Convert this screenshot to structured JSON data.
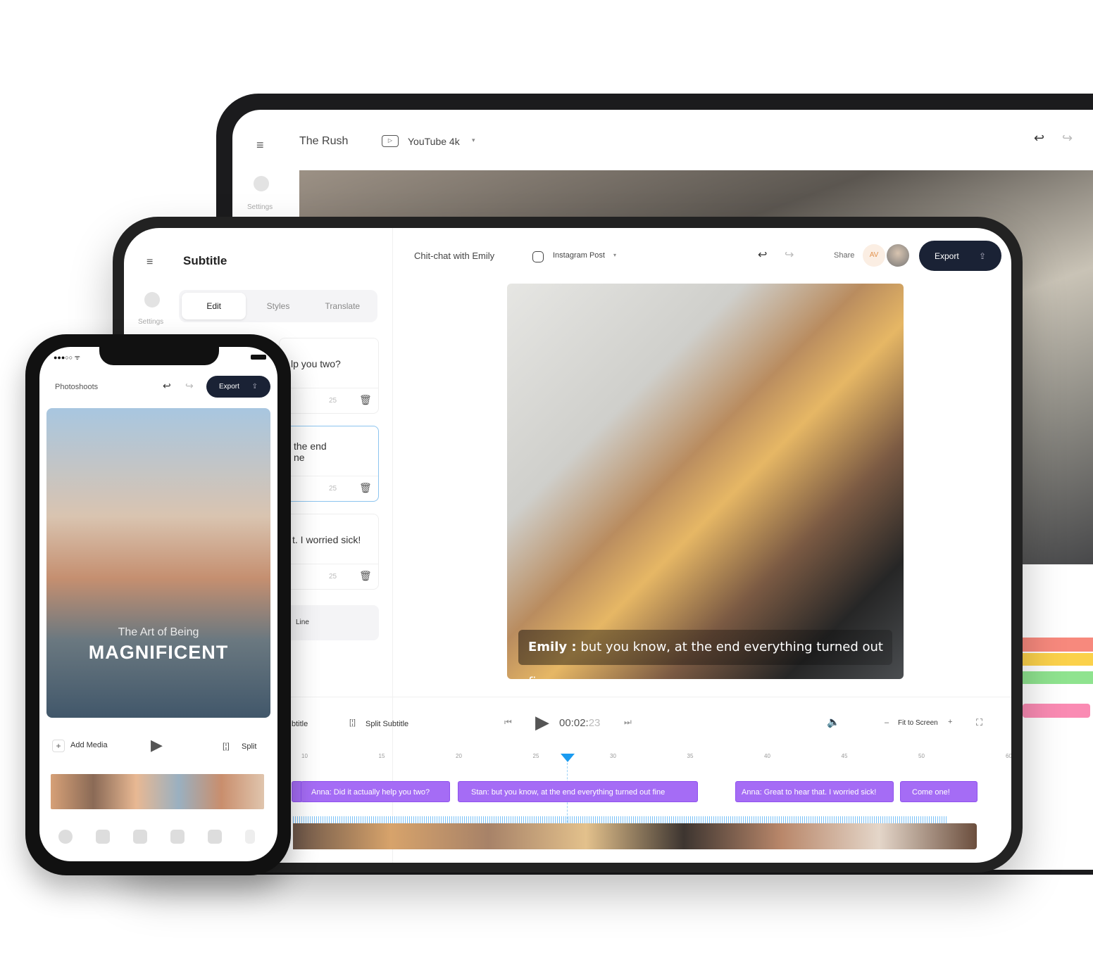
{
  "laptop": {
    "title": "The Rush",
    "format": "YouTube 4k",
    "settings_label": "Settings"
  },
  "tablet": {
    "panel_title": "Subtitle",
    "settings_label": "Settings",
    "tabs": [
      {
        "label": "Edit"
      },
      {
        "label": "Styles"
      },
      {
        "label": "Translate"
      }
    ],
    "cards": [
      {
        "text": "lp you two?",
        "count": "25"
      },
      {
        "text": "the end\nne",
        "count": "25"
      },
      {
        "text": "t. I worried sick!",
        "count": "25"
      }
    ],
    "add_line": "Line",
    "project": "Chit-chat with Emily",
    "format": "Instagram Post",
    "share": "Share",
    "avatar_initials": "AV",
    "export": "Export",
    "caption_speaker": "Emily :",
    "caption_text": " but you know, at the end everything turned out fine.",
    "toolbar": {
      "add_subtitle": "btitle",
      "split_subtitle": "Split Subtitle",
      "time": "00:02:",
      "frames": "23",
      "fit": "Fit to Screen"
    },
    "ruler": [
      "10",
      "15",
      "20",
      "25",
      "30",
      "35",
      "40",
      "45",
      "50",
      "60"
    ],
    "segments": [
      "",
      "Anna: Did it actually help you two?",
      "Stan: but you know, at the end everything turned out fine",
      "Anna: Great to hear that. I worried sick!",
      "Come one!"
    ],
    "accent": "#a56cf5",
    "playhead_color": "#1a9bf0"
  },
  "phone": {
    "project": "Photoshoots",
    "export": "Export",
    "title_small": "The Art of Being",
    "title_big": "MAGNIFICENT",
    "add_media": "Add Media",
    "split": "Split"
  }
}
